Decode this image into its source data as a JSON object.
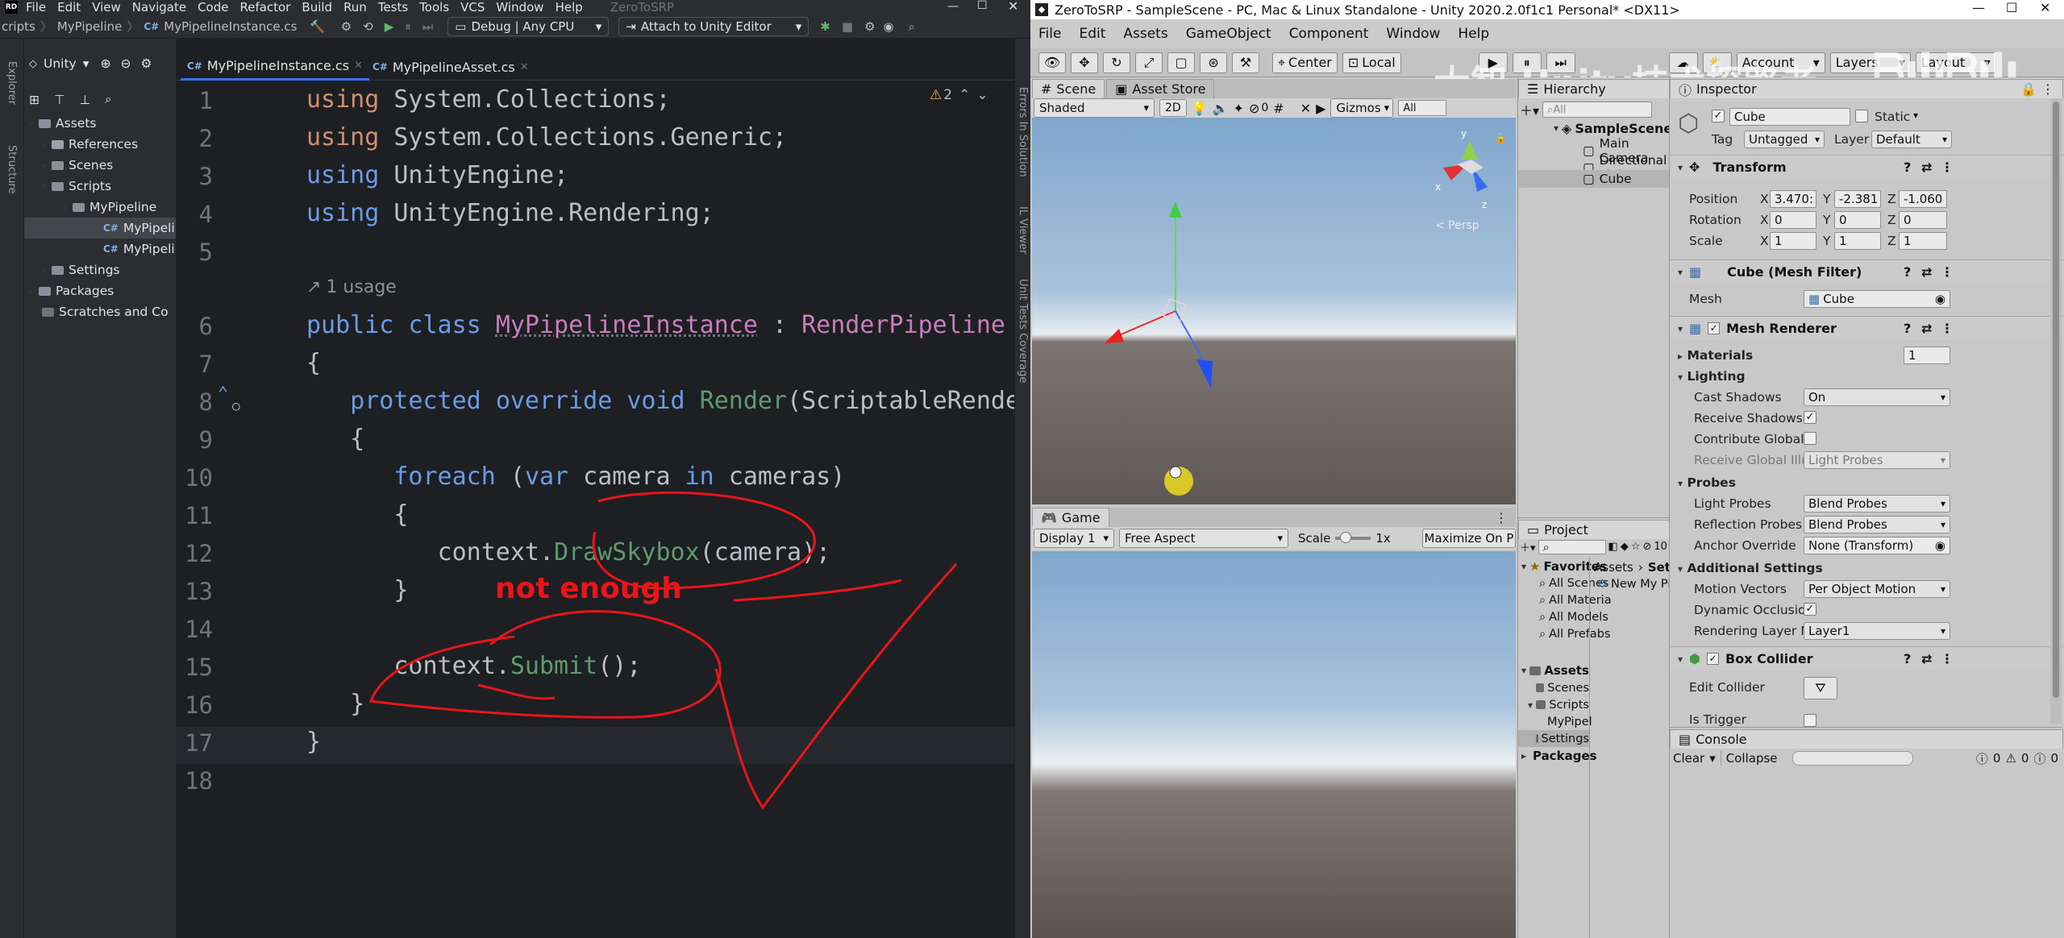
{
  "ide": {
    "menu": [
      "File",
      "Edit",
      "View",
      "Navigate",
      "Code",
      "Refactor",
      "Build",
      "Run",
      "Tests",
      "Tools",
      "VCS",
      "Window",
      "Help"
    ],
    "project_name": "ZeroToSRP",
    "breadcrumb": [
      "cripts",
      "MyPipeline",
      "MyPipelineInstance.cs"
    ],
    "config": "Debug | Any CPU",
    "attach": "Attach to Unity Editor",
    "side_labels": {
      "explorer": "Explorer",
      "structure": "Structure"
    },
    "right_labels": {
      "errors": "Errors In Solution",
      "il": "IL Viewer",
      "tests": "Unit Tests Coverage"
    },
    "explorer_title": "Unity",
    "tree": [
      {
        "label": "Assets"
      },
      {
        "label": "References"
      },
      {
        "label": "Scenes"
      },
      {
        "label": "Scripts"
      },
      {
        "label": "MyPipeline"
      },
      {
        "label": "MyPipeli"
      },
      {
        "label": "MyPipeli"
      },
      {
        "label": "Settings"
      },
      {
        "label": "Packages"
      },
      {
        "label": "Scratches and Co"
      }
    ],
    "tabs": [
      "MyPipelineInstance.cs",
      "MyPipelineAsset.cs"
    ],
    "warning_count": "2",
    "usage_hint": "1 usage",
    "line_numbers": [
      "1",
      "2",
      "3",
      "4",
      "5",
      "6",
      "7",
      "8",
      "9",
      "10",
      "11",
      "12",
      "13",
      "14",
      "15",
      "16",
      "17",
      "18"
    ],
    "code": {
      "using1_kw": "using",
      "using1_ns": " System.Collections;",
      "using2_kw": "using",
      "using2_ns": " System.Collections.Generic;",
      "using3_kw": "using",
      "using3_ns": " UnityEngine;",
      "using4_kw": "using",
      "using4_ns": " UnityEngine.Rendering;",
      "l6_public": "public",
      "l6_class": "class",
      "l6_name": "MyPipelineInstance",
      "l6_colon": " : ",
      "l6_base": "RenderPipeline",
      "l7": "{",
      "l8_protected": "protected",
      "l8_override": "override",
      "l8_void": "void",
      "l8_render": "Render",
      "l8_args": "(ScriptableRender",
      "l9": "{",
      "l10_foreach": "foreach",
      "l10_open": " (",
      "l10_var": "var",
      "l10_camera": " camera ",
      "l10_in": "in",
      "l10_rest": " cameras)",
      "l11": "{",
      "l12_ctx": "context.",
      "l12_fn": "DrawSkybox",
      "l12_rest": "(camera);",
      "l13": "}",
      "l15_ctx": "context.",
      "l15_fn": "Submit",
      "l15_rest": "();",
      "l16": "}",
      "l17": "}"
    },
    "annotation_text": "not enough",
    "annotation_color": "#e8161b"
  },
  "unity": {
    "title": "ZeroToSRP - SampleScene - PC, Mac & Linux Standalone - Unity 2020.2.0f1c1 Personal* <DX11>",
    "menu": [
      "File",
      "Edit",
      "Assets",
      "GameObject",
      "Component",
      "Window",
      "Help"
    ],
    "toolbar": {
      "center": "Center",
      "local": "Local",
      "account": "Account",
      "layers": "Layers",
      "layout": "Layout"
    },
    "watermark": "大智 Unity技术探路者",
    "scene_tabs": [
      "Scene",
      "Asset Store"
    ],
    "scene_bar": {
      "shading": "Shaded",
      "mode": "2D",
      "gizmo_count": "0",
      "gizmos": "Gizmos",
      "search": "All"
    },
    "persp": "< Persp",
    "game_tab": "Game",
    "game_bar": {
      "display": "Display 1",
      "aspect": "Free Aspect",
      "scale": "Scale",
      "scale_value": "1x",
      "maximize": "Maximize On P"
    },
    "hierarchy": {
      "title": "Hierarchy",
      "search": "All",
      "scene": "SampleScene*",
      "items": [
        "Main Camera",
        "Directional Light",
        "Cube"
      ]
    },
    "project": {
      "title": "Project",
      "hidden_count": "10",
      "favorites": "Favorites",
      "fav_items": [
        "All Scenes",
        "All Materia",
        "All Models",
        "All Prefabs"
      ],
      "assets": "Assets",
      "asset_items": [
        "Scenes",
        "Scripts",
        "MyPipel",
        "Settings"
      ],
      "packages": "Packages",
      "path": [
        "Assets",
        "Settings"
      ],
      "file": "New My Pipelin"
    },
    "inspector": {
      "title": "Inspector",
      "object_name": "Cube",
      "static_label": "Static",
      "tag_label": "Tag",
      "tag": "Untagged",
      "layer_label": "Layer",
      "layer": "Default",
      "transform": "Transform",
      "position_label": "Position",
      "position": {
        "x": "3.470:",
        "y": "-2.381",
        "z": "-1.060"
      },
      "rotation_label": "Rotation",
      "rotation": {
        "x": "0",
        "y": "0",
        "z": "0"
      },
      "scale_label": "Scale",
      "scale": {
        "x": "1",
        "y": "1",
        "z": "1"
      },
      "mesh_filter": "Cube (Mesh Filter)",
      "mesh_label": "Mesh",
      "mesh": "Cube",
      "mesh_renderer": "Mesh Renderer",
      "materials_label": "Materials",
      "materials": "1",
      "lighting": "Lighting",
      "cast_shadows_label": "Cast Shadows",
      "cast_shadows": "On",
      "receive_shadows_label": "Receive Shadows",
      "contribute_gi_label": "Contribute Global I",
      "receive_gi_label": "Receive Global Illu",
      "receive_gi": "Light Probes",
      "probes": "Probes",
      "light_probes_label": "Light Probes",
      "light_probes": "Blend Probes",
      "reflection_probes_label": "Reflection Probes",
      "reflection_probes": "Blend Probes",
      "anchor_label": "Anchor Override",
      "anchor": "None (Transform)",
      "additional": "Additional Settings",
      "motion_label": "Motion Vectors",
      "motion": "Per Object Motion",
      "dynamic_occ_label": "Dynamic Occlusion",
      "rendering_layer_label": "Rendering Layer M",
      "rendering_layer": "Layer1",
      "box_collider": "Box Collider",
      "edit_collider_label": "Edit Collider",
      "is_trigger_label": "Is Trigger"
    },
    "console": {
      "title": "Console",
      "clear": "Clear",
      "collapse": "Collapse",
      "errors": "0",
      "warnings": "0",
      "logs": "0"
    }
  }
}
